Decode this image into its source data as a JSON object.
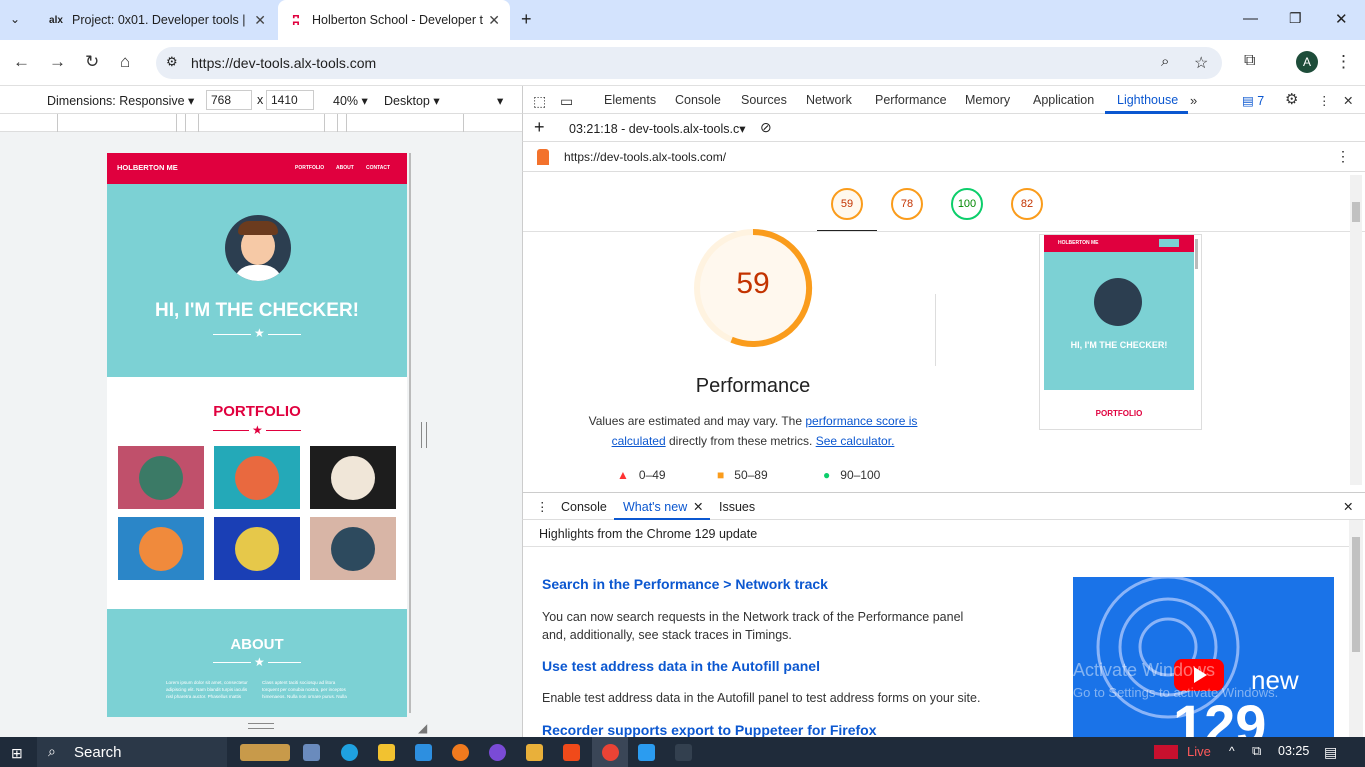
{
  "browser": {
    "tabs": [
      {
        "favicon_text": "alx",
        "title": "Project: 0x01. Developer tools |",
        "active": false
      },
      {
        "favicon_text": "",
        "title": "Holberton School - Developer t",
        "active": true
      }
    ],
    "url": "https://dev-tools.alx-tools.com",
    "avatar_letter": "A"
  },
  "device_toolbar": {
    "dimensions_label": "Dimensions: Responsive",
    "width": "768",
    "times": "x",
    "height": "1410",
    "zoom": "40%",
    "device_type": "Desktop"
  },
  "preview": {
    "brand": "HOLBERTON ME",
    "nav": [
      "PORTFOLIO",
      "ABOUT",
      "CONTACT"
    ],
    "hero_title": "HI, I'M THE CHECKER!",
    "portfolio_title": "PORTFOLIO",
    "about_title": "ABOUT",
    "about_col1": "Lorem ipsum dolor sit amet, consectetur adipiscing elit. Nam blandit turpis iaculis nisl pharetra auctor. Phasellus mattis",
    "about_col2": "Class aptent taciti sociosqu ad litora torquent per conubia nostra, per inceptos himenaeos. Nulla non ornare purus. Nulla"
  },
  "devtools": {
    "tabs": [
      "Elements",
      "Console",
      "Sources",
      "Network",
      "Performance",
      "Memory",
      "Application",
      "Lighthouse"
    ],
    "active_tab": "Lighthouse",
    "issues_count": "7",
    "report_selector": "03:21:18 - dev-tools.alx-tools.c",
    "report_url": "https://dev-tools.alx-tools.com/",
    "gauges": [
      "59",
      "78",
      "100",
      "82"
    ],
    "main_score": "59",
    "category": "Performance",
    "description_pre": "Values are estimated and may vary. The ",
    "link_score": "performance score is calculated",
    "description_mid": " directly from these metrics. ",
    "link_calc": "See calculator.",
    "legend": [
      "0–49",
      "50–89",
      "90–100"
    ],
    "screenshot": {
      "brand": "HOLBERTON ME",
      "hero_title": "HI, I'M THE CHECKER!",
      "portfolio_title": "PORTFOLIO"
    }
  },
  "drawer": {
    "tabs": [
      "Console",
      "What's new",
      "Issues"
    ],
    "active_tab": "What's new",
    "highlight": "Highlights from the Chrome 129 update",
    "items": [
      {
        "title": "Search in the Performance > Network track",
        "body": "You can now search requests in the Network track of the Performance panel and, additionally, see stack traces in Timings."
      },
      {
        "title": "Use test address data in the Autofill panel",
        "body": "Enable test address data in the Autofill panel to test address forms on your site."
      },
      {
        "title": "Recorder supports export to Puppeteer for Firefox",
        "body": ""
      }
    ],
    "video_badge": "new",
    "video_number": "129",
    "watermark_line1": "Activate Windows",
    "watermark_line2": "Go to Settings to activate Windows."
  },
  "taskbar": {
    "search": "Search",
    "live": "Live",
    "time": "03:25"
  },
  "colors": {
    "brand_red": "#e0003e",
    "hero_teal": "#7cd1d4",
    "score_orange": "#fa9c1c",
    "score_green": "#0cce6b",
    "link_blue": "#0b57d0"
  }
}
